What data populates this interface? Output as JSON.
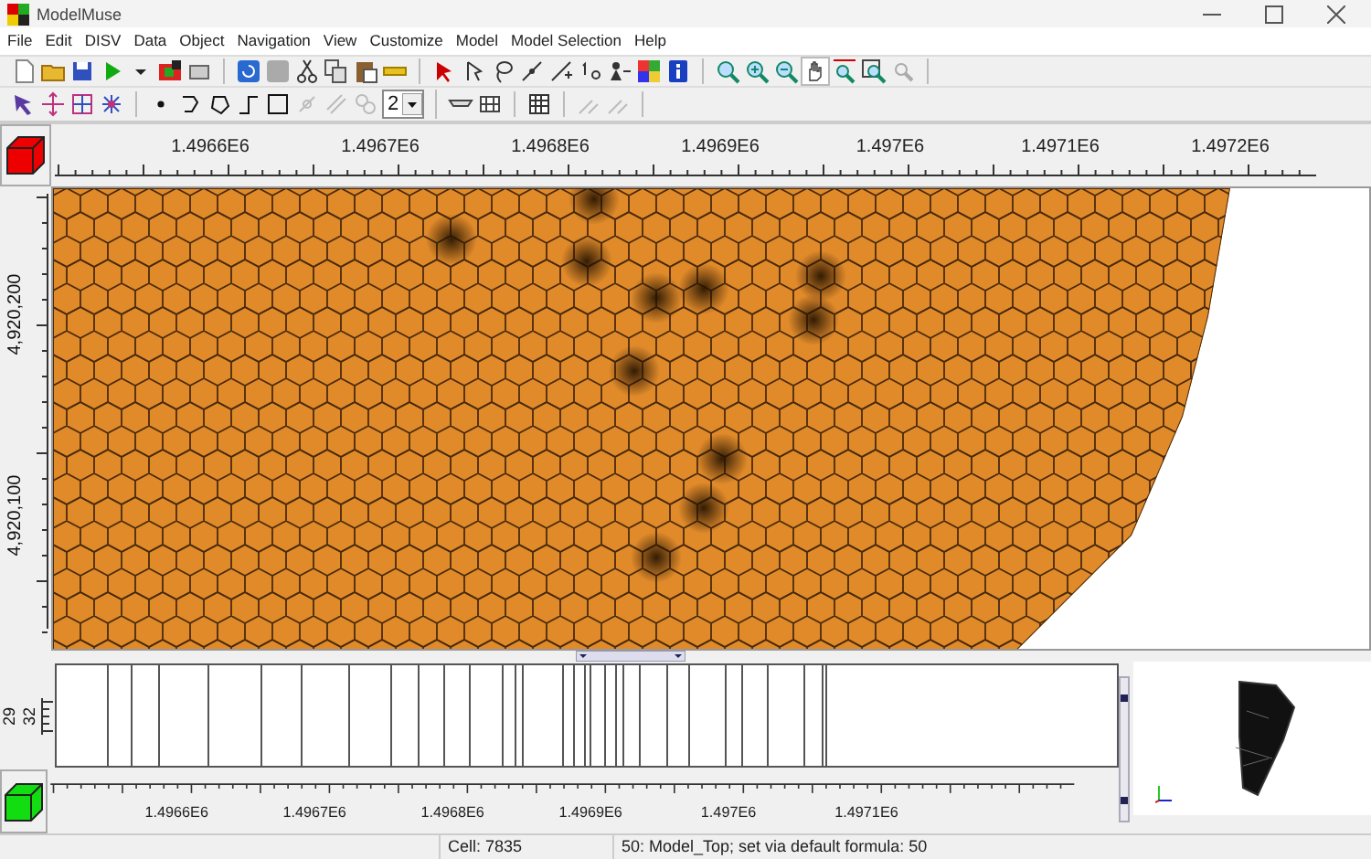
{
  "window": {
    "title": "ModelMuse"
  },
  "menu": [
    "File",
    "Edit",
    "DISV",
    "Data",
    "Object",
    "Navigation",
    "View",
    "Customize",
    "Model",
    "Model Selection",
    "Help"
  ],
  "toolbar": {
    "layer_spin": "2"
  },
  "top_ruler": {
    "labels": [
      "1.4966E6",
      "1.4967E6",
      "1.4968E6",
      "1.4969E6",
      "1.497E6",
      "1.4971E6",
      "1.4972E6"
    ]
  },
  "left_ruler": {
    "labels": [
      "4,920,200",
      "4,920,100"
    ]
  },
  "front_ruler": {
    "labels": [
      "29",
      "32"
    ]
  },
  "bottom_ruler": {
    "labels": [
      "1.4966E6",
      "1.4967E6",
      "1.4968E6",
      "1.4969E6",
      "1.497E6",
      "1.4971E6"
    ]
  },
  "status_bar": [
    "Cell: 7835",
    "50: Model_Top; set via default formula: 50"
  ]
}
